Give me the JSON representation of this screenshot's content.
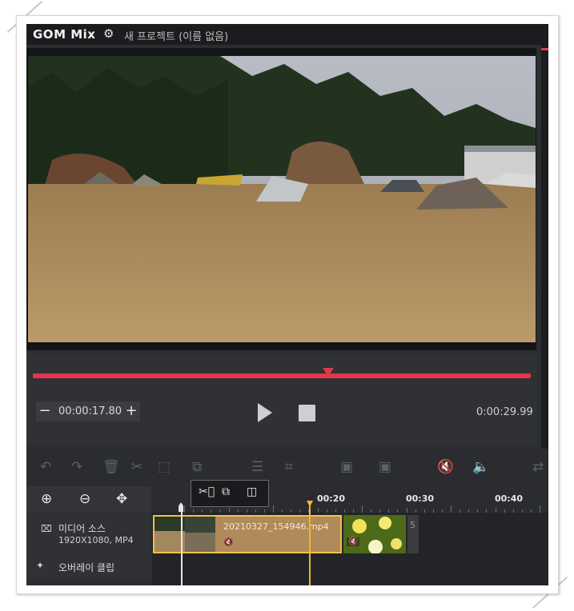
{
  "app": {
    "logo": "GOM Mix",
    "project_title": "새 프로젝트 (이름 없음)"
  },
  "player": {
    "current_time": "00:00:17.80",
    "total_time": "0:00:29.99",
    "progress": 0.593
  },
  "timeline": {
    "ruler_labels": [
      "00:20",
      "00:30",
      "00:40"
    ],
    "tracks": {
      "media_label": "미디어 소스",
      "media_info": "1920X1080, MP4",
      "overlay_label": "오버레이 클립"
    },
    "clip_name": "20210327_154946.mp4",
    "clip3_text": "5"
  },
  "colors": {
    "accent_red": "#e2364a",
    "playhead_yellow": "#f2b532",
    "clip_border": "#f0c24a"
  },
  "icons": [
    "gear-icon",
    "undo-icon",
    "redo-icon",
    "trash-icon",
    "cut-icon",
    "select-icon",
    "split-icon",
    "adjust-icon",
    "crop-icon",
    "image-icon",
    "mute-icon",
    "zoom-in-icon",
    "zoom-out-icon",
    "move-icon",
    "film-icon",
    "overlay-icon"
  ]
}
